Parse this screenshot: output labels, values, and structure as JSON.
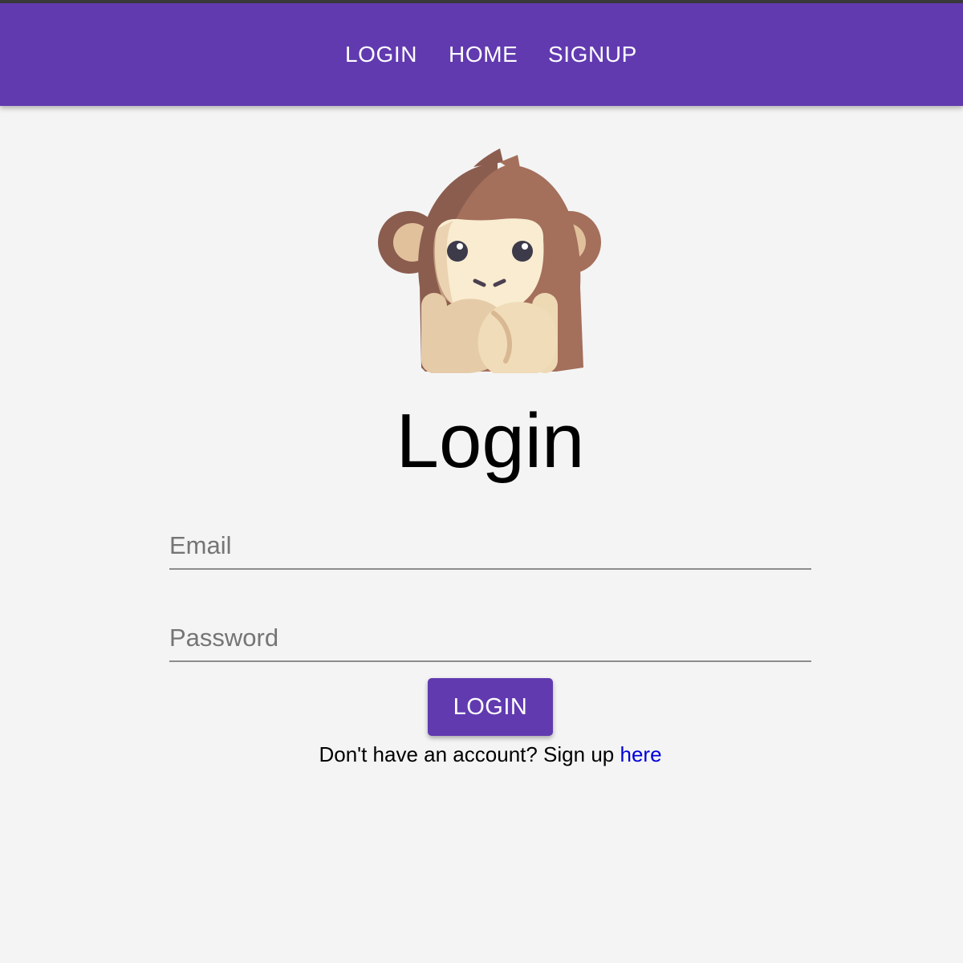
{
  "nav": {
    "items": [
      {
        "label": "LOGIN"
      },
      {
        "label": "HOME"
      },
      {
        "label": "SIGNUP"
      }
    ]
  },
  "page": {
    "title": "Login"
  },
  "form": {
    "email": {
      "value": "",
      "placeholder": "Email"
    },
    "password": {
      "value": "",
      "placeholder": "Password"
    },
    "submit_label": "LOGIN"
  },
  "signup_prompt": {
    "text": "Don't have an account? Sign up",
    "link_text": "here"
  },
  "icons": {
    "logo": "monkey-covering-mouth-icon"
  },
  "colors": {
    "primary": "#613ab0",
    "background": "#f4f4f4",
    "link": "#0000dd"
  }
}
